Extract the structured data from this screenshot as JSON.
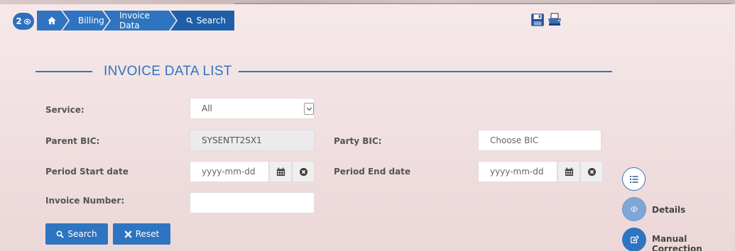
{
  "badge": {
    "count": "2"
  },
  "breadcrumb": {
    "items": [
      {
        "label": ""
      },
      {
        "label": "Billing"
      },
      {
        "label": "Invoice Data"
      },
      {
        "label": "Search"
      }
    ]
  },
  "section": {
    "title": "INVOICE DATA LIST"
  },
  "form": {
    "service": {
      "label": "Service:",
      "value": "All"
    },
    "parent_bic": {
      "label": "Parent BIC:",
      "value": "SYSENTT2SX1"
    },
    "party_bic": {
      "label": "Party BIC:",
      "placeholder": "Choose BIC"
    },
    "period_start": {
      "label": "Period Start date",
      "placeholder": "yyyy-mm-dd"
    },
    "period_end": {
      "label": "Period End date",
      "placeholder": "yyyy-mm-dd"
    },
    "invoice_number": {
      "label": "Invoice Number:",
      "value": ""
    }
  },
  "buttons": {
    "search": "Search",
    "reset": "Reset"
  },
  "side_actions": {
    "details": "Details",
    "manual_correction": "Manual Correction"
  },
  "colors": {
    "primary": "#2f74c0",
    "secondary_circle": "#7ea6d6"
  },
  "icons": [
    "eye-icon",
    "home-icon",
    "search-icon",
    "save-icon",
    "print-icon",
    "calendar-icon",
    "clear-icon",
    "list-icon",
    "edit-icon",
    "times-icon",
    "chevron-down-icon"
  ]
}
